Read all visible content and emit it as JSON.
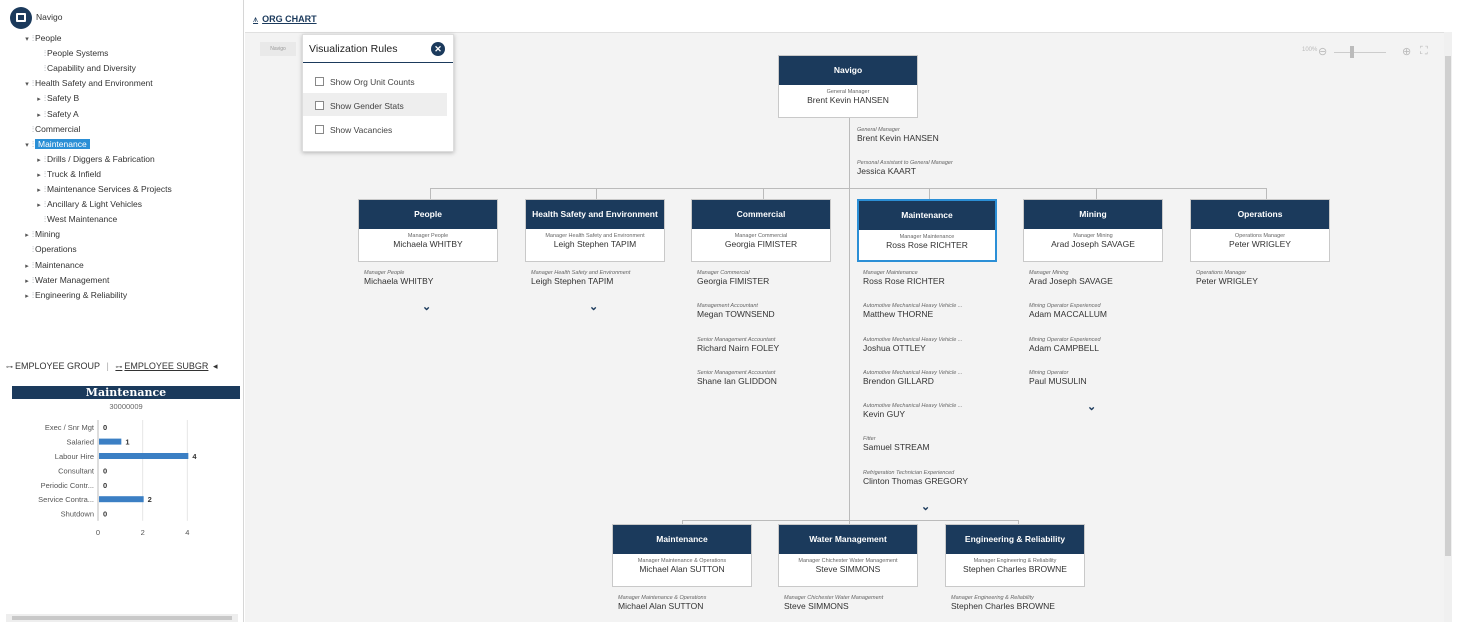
{
  "tree": {
    "root": "Navigo",
    "items": [
      {
        "label": "People",
        "expand": "▾"
      },
      {
        "label": "People Systems",
        "expand": ""
      },
      {
        "label": "Capability and Diversity",
        "expand": ""
      },
      {
        "label": "Health Safety and Environment",
        "expand": "▾"
      },
      {
        "label": "Safety B",
        "expand": "▸"
      },
      {
        "label": "Safety A",
        "expand": "▸"
      },
      {
        "label": "Commercial",
        "expand": ""
      },
      {
        "label": "Maintenance",
        "expand": "▾"
      },
      {
        "label": "Drills / Diggers & Fabrication",
        "expand": "▸"
      },
      {
        "label": "Truck & Infield",
        "expand": "▸"
      },
      {
        "label": "Maintenance Services & Projects",
        "expand": "▸"
      },
      {
        "label": "Ancillary & Light Vehicles",
        "expand": "▸"
      },
      {
        "label": "West Maintenance",
        "expand": ""
      },
      {
        "label": "Mining",
        "expand": "▸"
      },
      {
        "label": "Operations",
        "expand": ""
      },
      {
        "label": "Maintenance",
        "expand": "▸"
      },
      {
        "label": "Water Management",
        "expand": "▸"
      },
      {
        "label": "Engineering & Reliability",
        "expand": "▸"
      }
    ]
  },
  "tabs": {
    "employee_group": "EMPLOYEE GROUP",
    "employee_subgroup": "EMPLOYEE SUBGR",
    "scroll_arrow": "◂"
  },
  "emp_chart_panel": {
    "title": "Maintenance",
    "code": "30000009"
  },
  "chart_data": {
    "type": "bar",
    "orientation": "horizontal",
    "categories": [
      "Exec / Snr Mgt",
      "Salaried",
      "Labour Hire",
      "Consultant",
      "Periodic Contr...",
      "Service Contra...",
      "Shutdown"
    ],
    "values": [
      0,
      1,
      4,
      0,
      0,
      2,
      0
    ],
    "xlim": [
      0,
      6
    ],
    "xticks": [
      "0",
      "2",
      "4",
      "6"
    ],
    "bar_color": "#3b7fc4",
    "grid": true
  },
  "main": {
    "title": "ORG CHART",
    "navigo_chip": "Navigo",
    "zoom_label": "100%"
  },
  "vis_rules": {
    "title": "Visualization Rules",
    "close": "✕",
    "options": [
      "Show Org Unit Counts",
      "Show Gender Stats",
      "Show Vacancies"
    ]
  },
  "org": {
    "root": {
      "title": "Navigo",
      "role": "General Manager",
      "name": "Brent Kevin HANSEN"
    },
    "root_positions": [
      {
        "role": "General Manager",
        "name": "Brent Kevin HANSEN"
      },
      {
        "role": "Personal Assistant to General Manager",
        "name": "Jessica KAART"
      }
    ],
    "level1": [
      {
        "title": "People",
        "role": "Manager People",
        "name": "Michaela WHITBY",
        "positions": [
          {
            "role": "Manager People",
            "name": "Michaela WHITBY"
          }
        ],
        "more": "⌄"
      },
      {
        "title": "Health Safety and Environment",
        "role": "Manager Health Safety and Environment",
        "name": "Leigh Stephen TAPIM",
        "positions": [
          {
            "role": "Manager Health Safety and Environment",
            "name": "Leigh Stephen TAPIM"
          }
        ],
        "more": "⌄"
      },
      {
        "title": "Commercial",
        "role": "Manager Commercial",
        "name": "Georgia FIMISTER",
        "positions": [
          {
            "role": "Manager Commercial",
            "name": "Georgia FIMISTER"
          },
          {
            "role": "Management Accountant",
            "name": "Megan TOWNSEND"
          },
          {
            "role": "Senior Management Accountant",
            "name": "Richard Nairn FOLEY"
          },
          {
            "role": "Senior Management Accountant",
            "name": "Shane Ian GLIDDON"
          }
        ],
        "more": ""
      },
      {
        "title": "Maintenance",
        "role": "Manager Maintenance",
        "name": "Ross Rose RICHTER",
        "positions": [
          {
            "role": "Manager Maintenance",
            "name": "Ross Rose RICHTER"
          },
          {
            "role": "Automotive Mechanical Heavy Vehicle ...",
            "name": "Matthew THORNE"
          },
          {
            "role": "Automotive Mechanical Heavy Vehicle ...",
            "name": "Joshua OTTLEY"
          },
          {
            "role": "Automotive Mechanical Heavy Vehicle ...",
            "name": "Brendon GILLARD"
          },
          {
            "role": "Automotive Mechanical Heavy Vehicle ...",
            "name": "Kevin GUY"
          },
          {
            "role": "Fitter",
            "name": "Samuel STREAM"
          },
          {
            "role": "Refrigeration Technician Experienced",
            "name": "Clinton Thomas GREGORY"
          }
        ],
        "more": "⌄"
      },
      {
        "title": "Mining",
        "role": "Manager Mining",
        "name": "Arad Joseph SAVAGE",
        "positions": [
          {
            "role": "Manager Mining",
            "name": "Arad Joseph SAVAGE"
          },
          {
            "role": "Mining Operator Experienced",
            "name": "Adam MACCALLUM"
          },
          {
            "role": "Mining Operator Experienced",
            "name": "Adam CAMPBELL"
          },
          {
            "role": "Mining Operator",
            "name": "Paul MUSULIN"
          }
        ],
        "more": "⌄"
      },
      {
        "title": "Operations",
        "role": "Operations Manager",
        "name": "Peter WRIGLEY",
        "positions": [
          {
            "role": "Operations Manager",
            "name": "Peter WRIGLEY"
          }
        ],
        "more": ""
      }
    ],
    "level2": [
      {
        "title": "Maintenance",
        "role": "Manager Maintenance & Operations",
        "name": "Michael Alan SUTTON",
        "positions": [
          {
            "role": "Manager Maintenance & Operations",
            "name": "Michael Alan SUTTON"
          }
        ]
      },
      {
        "title": "Water Management",
        "role": "Manager Chichester Water Management",
        "name": "Steve SIMMONS",
        "positions": [
          {
            "role": "Manager Chichester Water Management",
            "name": "Steve SIMMONS"
          }
        ]
      },
      {
        "title": "Engineering & Reliability",
        "role": "Manager Engineering & Reliability",
        "name": "Stephen Charles BROWNE",
        "positions": [
          {
            "role": "Manager Engineering & Reliability",
            "name": "Stephen Charles BROWNE"
          }
        ]
      }
    ]
  }
}
